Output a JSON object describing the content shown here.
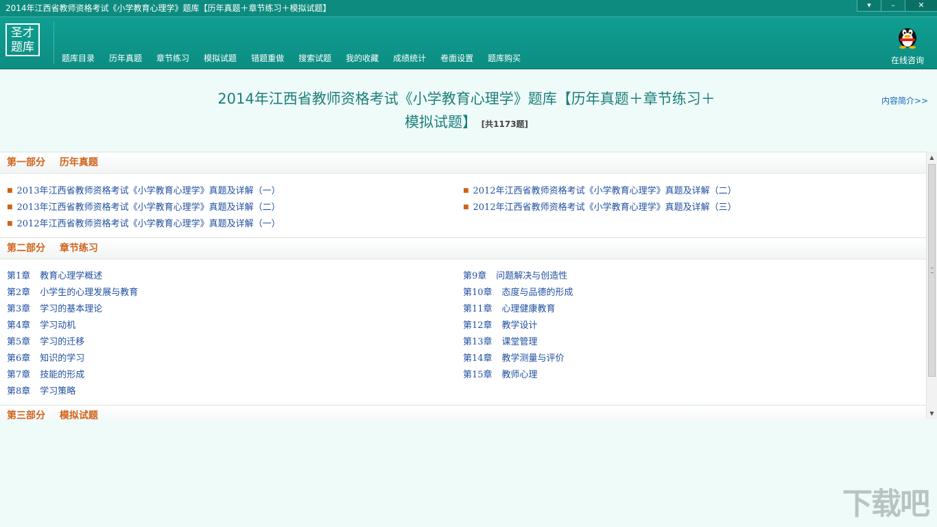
{
  "window": {
    "title": "2014年江西省教师资格考试《小学教育心理学》题库【历年真题＋章节练习＋模拟试题】",
    "buttons": [
      "▾",
      "–",
      "✕"
    ]
  },
  "header": {
    "logo_line1": "圣才",
    "logo_line2": "题库",
    "nav": [
      "题库目录",
      "历年真题",
      "章节练习",
      "模拟试题",
      "错题重做",
      "搜索试题",
      "我的收藏",
      "成绩统计",
      "卷面设置",
      "题库购买"
    ],
    "qq_label": "在线咨询"
  },
  "main": {
    "title_line1": "2014年江西省教师资格考试《小学教育心理学》题库【历年真题＋章节练习＋",
    "title_line2": "模拟试题】",
    "count": "[共1173题]",
    "intro_link": "内容简介>>"
  },
  "sections": {
    "s1": {
      "num": "第一部分",
      "name": "历年真题",
      "left": [
        "2013年江西省教师资格考试《小学教育心理学》真题及详解（一）",
        "2013年江西省教师资格考试《小学教育心理学》真题及详解（二）",
        "2012年江西省教师资格考试《小学教育心理学》真题及详解（一）"
      ],
      "right": [
        "2012年江西省教师资格考试《小学教育心理学》真题及详解（二）",
        "2012年江西省教师资格考试《小学教育心理学》真题及详解（三）"
      ]
    },
    "s2": {
      "num": "第二部分",
      "name": "章节练习",
      "left": [
        {
          "n": "第1章",
          "t": "教育心理学概述"
        },
        {
          "n": "第2章",
          "t": "小学生的心理发展与教育"
        },
        {
          "n": "第3章",
          "t": "学习的基本理论"
        },
        {
          "n": "第4章",
          "t": "学习动机"
        },
        {
          "n": "第5章",
          "t": "学习的迁移"
        },
        {
          "n": "第6章",
          "t": "知识的学习"
        },
        {
          "n": "第7章",
          "t": "技能的形成"
        },
        {
          "n": "第8章",
          "t": "学习策略"
        }
      ],
      "right": [
        {
          "n": "第9章",
          "t": "问题解决与创造性"
        },
        {
          "n": "第10章",
          "t": "态度与品德的形成"
        },
        {
          "n": "第11章",
          "t": "心理健康教育"
        },
        {
          "n": "第12章",
          "t": "教学设计"
        },
        {
          "n": "第13章",
          "t": "课堂管理"
        },
        {
          "n": "第14章",
          "t": "教学测量与评价"
        },
        {
          "n": "第15章",
          "t": "教师心理"
        }
      ]
    },
    "s3": {
      "num": "第三部分",
      "name": "模拟试题"
    }
  },
  "watermark": "下载吧"
}
